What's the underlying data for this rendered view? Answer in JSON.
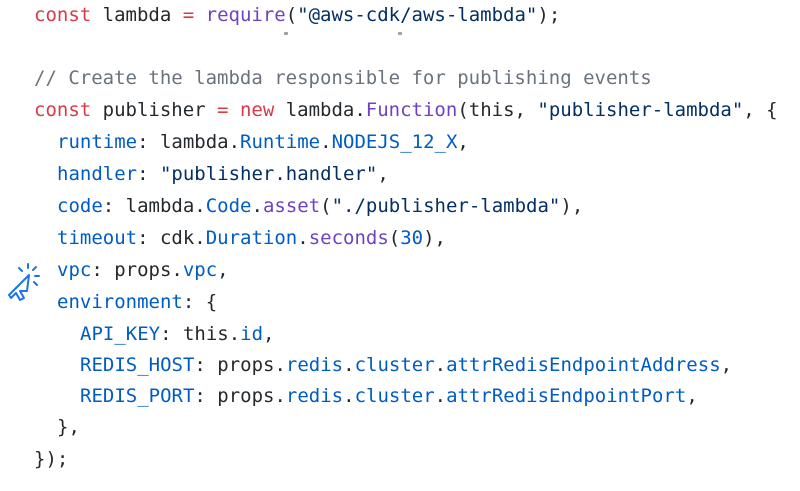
{
  "code": {
    "lines": [
      {
        "indent": 0,
        "tokens": [
          {
            "t": "const",
            "c": "kw"
          },
          {
            "t": " lambda ",
            "c": "pl"
          },
          {
            "t": "=",
            "c": "kw"
          },
          {
            "t": " ",
            "c": "pl"
          },
          {
            "t": "require",
            "c": "fn"
          },
          {
            "t": "(",
            "c": "pl"
          },
          {
            "t": "\"@aws-cdk/aws-lambda\"",
            "c": "str"
          },
          {
            "t": ");",
            "c": "pl"
          }
        ]
      },
      {
        "indent": 0,
        "tokens": []
      },
      {
        "indent": 0,
        "tokens": [
          {
            "t": "// Create the lambda responsible for publishing events",
            "c": "cmt"
          }
        ]
      },
      {
        "indent": 0,
        "tokens": [
          {
            "t": "const",
            "c": "kw"
          },
          {
            "t": " publisher ",
            "c": "pl"
          },
          {
            "t": "=",
            "c": "kw"
          },
          {
            "t": " ",
            "c": "pl"
          },
          {
            "t": "new",
            "c": "kw"
          },
          {
            "t": " lambda.",
            "c": "pl"
          },
          {
            "t": "Function",
            "c": "fn"
          },
          {
            "t": "(this, ",
            "c": "pl"
          },
          {
            "t": "\"publisher-lambda\"",
            "c": "str"
          },
          {
            "t": ", {",
            "c": "pl"
          }
        ]
      },
      {
        "indent": 1,
        "tokens": [
          {
            "t": "runtime",
            "c": "prop"
          },
          {
            "t": ": lambda.",
            "c": "pl"
          },
          {
            "t": "Runtime",
            "c": "prop"
          },
          {
            "t": ".",
            "c": "pl"
          },
          {
            "t": "NODEJS_12_X",
            "c": "prop"
          },
          {
            "t": ",",
            "c": "pl"
          }
        ]
      },
      {
        "indent": 1,
        "tokens": [
          {
            "t": "handler",
            "c": "prop"
          },
          {
            "t": ": ",
            "c": "pl"
          },
          {
            "t": "\"publisher.handler\"",
            "c": "str"
          },
          {
            "t": ",",
            "c": "pl"
          }
        ]
      },
      {
        "indent": 1,
        "tokens": [
          {
            "t": "code",
            "c": "prop"
          },
          {
            "t": ": lambda.",
            "c": "pl"
          },
          {
            "t": "Code",
            "c": "prop"
          },
          {
            "t": ".",
            "c": "pl"
          },
          {
            "t": "asset",
            "c": "fn"
          },
          {
            "t": "(",
            "c": "pl"
          },
          {
            "t": "\"./publisher-lambda\"",
            "c": "str"
          },
          {
            "t": "),",
            "c": "pl"
          }
        ]
      },
      {
        "indent": 1,
        "tokens": [
          {
            "t": "timeout",
            "c": "prop"
          },
          {
            "t": ": cdk.",
            "c": "pl"
          },
          {
            "t": "Duration",
            "c": "prop"
          },
          {
            "t": ".",
            "c": "pl"
          },
          {
            "t": "seconds",
            "c": "fn"
          },
          {
            "t": "(",
            "c": "pl"
          },
          {
            "t": "30",
            "c": "num"
          },
          {
            "t": "),",
            "c": "pl"
          }
        ]
      },
      {
        "indent": 1,
        "tokens": [
          {
            "t": "vpc",
            "c": "prop"
          },
          {
            "t": ": props.",
            "c": "pl"
          },
          {
            "t": "vpc",
            "c": "prop"
          },
          {
            "t": ",",
            "c": "pl"
          }
        ]
      },
      {
        "indent": 1,
        "tokens": [
          {
            "t": "environment",
            "c": "prop"
          },
          {
            "t": ": {",
            "c": "pl"
          }
        ]
      },
      {
        "indent": 2,
        "tokens": [
          {
            "t": "API_KEY",
            "c": "prop"
          },
          {
            "t": ": this.",
            "c": "pl"
          },
          {
            "t": "id",
            "c": "prop"
          },
          {
            "t": ",",
            "c": "pl"
          }
        ]
      },
      {
        "indent": 2,
        "tokens": [
          {
            "t": "REDIS_HOST",
            "c": "prop"
          },
          {
            "t": ": props.",
            "c": "pl"
          },
          {
            "t": "redis",
            "c": "prop"
          },
          {
            "t": ".",
            "c": "pl"
          },
          {
            "t": "cluster",
            "c": "prop"
          },
          {
            "t": ".",
            "c": "pl"
          },
          {
            "t": "attrRedisEndpointAddress",
            "c": "prop"
          },
          {
            "t": ",",
            "c": "pl"
          }
        ]
      },
      {
        "indent": 2,
        "tokens": [
          {
            "t": "REDIS_PORT",
            "c": "prop"
          },
          {
            "t": ": props.",
            "c": "pl"
          },
          {
            "t": "redis",
            "c": "prop"
          },
          {
            "t": ".",
            "c": "pl"
          },
          {
            "t": "cluster",
            "c": "prop"
          },
          {
            "t": ".",
            "c": "pl"
          },
          {
            "t": "attrRedisEndpointPort",
            "c": "prop"
          },
          {
            "t": ",",
            "c": "pl"
          }
        ]
      },
      {
        "indent": 1,
        "tokens": [
          {
            "t": "},",
            "c": "pl"
          }
        ]
      },
      {
        "indent": 0,
        "tokens": [
          {
            "t": "});",
            "c": "pl"
          }
        ]
      }
    ]
  },
  "icons": {
    "cursor": "click-cursor-icon"
  },
  "colors": {
    "keyword": "#d73a49",
    "function": "#6f42c1",
    "string": "#032f62",
    "property": "#005cc5",
    "comment": "#6a737d",
    "plain": "#24292e",
    "cursor": "#1a73e8"
  }
}
